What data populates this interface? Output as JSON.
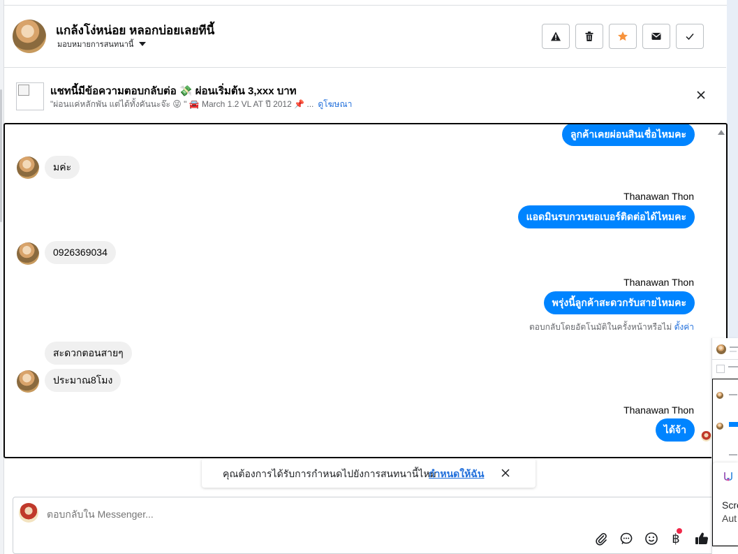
{
  "header": {
    "title": "แกล้งโง่หน่อย หลอกบ่อยเลยทีนี้",
    "assign_label": "มอบหมายการสนทนานี้"
  },
  "ad": {
    "title": "แชทนี้มีข้อความตอบกลับต่อ 💸 ผ่อนเริ่มต้น 3,xxx บาท",
    "description": "\"ผ่อนแค่หลักพัน แต่ได้ทั้งคันนะจ๊ะ 😜 \" 🚘 March 1.2 VL AT ปี 2012 📌 ...",
    "link": "ดูโฆษณา"
  },
  "messages": {
    "m1": "ลูกค้าเคยผ่อนสินเชื่อไหมคะ",
    "m2": "มค่ะ",
    "sender1": "Thanawan Thon",
    "m3": "แอดมินรบกวนขอเบอร์ติดต่อได้ไหมคะ",
    "m4": "0926369034",
    "sender2": "Thanawan Thon",
    "m5": "พรุ่งนี้ลูกค้าสะดวกรับสายไหมคะ",
    "autoreply_text": "ตอบกลับโดยอัตโนมัติในครั้งหน้าหรือไม่",
    "autoreply_link": "ตั้งค่า",
    "m6": "สะดวกตอนสายๆ",
    "m7": "ประมาณ8โมง",
    "sender3": "Thanawan Thon",
    "m8": "ได้จ้า"
  },
  "assign_bar": {
    "text": "คุณต้องการได้รับการกำหนดไปยังการสนทนานี้ไหม",
    "link": "กำหนดให้ฉัน"
  },
  "composer": {
    "placeholder": "ตอบกลับใน Messenger..."
  },
  "mini_popup": {
    "line1": "Scre",
    "line2": "Aut"
  },
  "colors": {
    "accent": "#0084ff",
    "link": "#216fdb",
    "star": "#f7923b"
  }
}
